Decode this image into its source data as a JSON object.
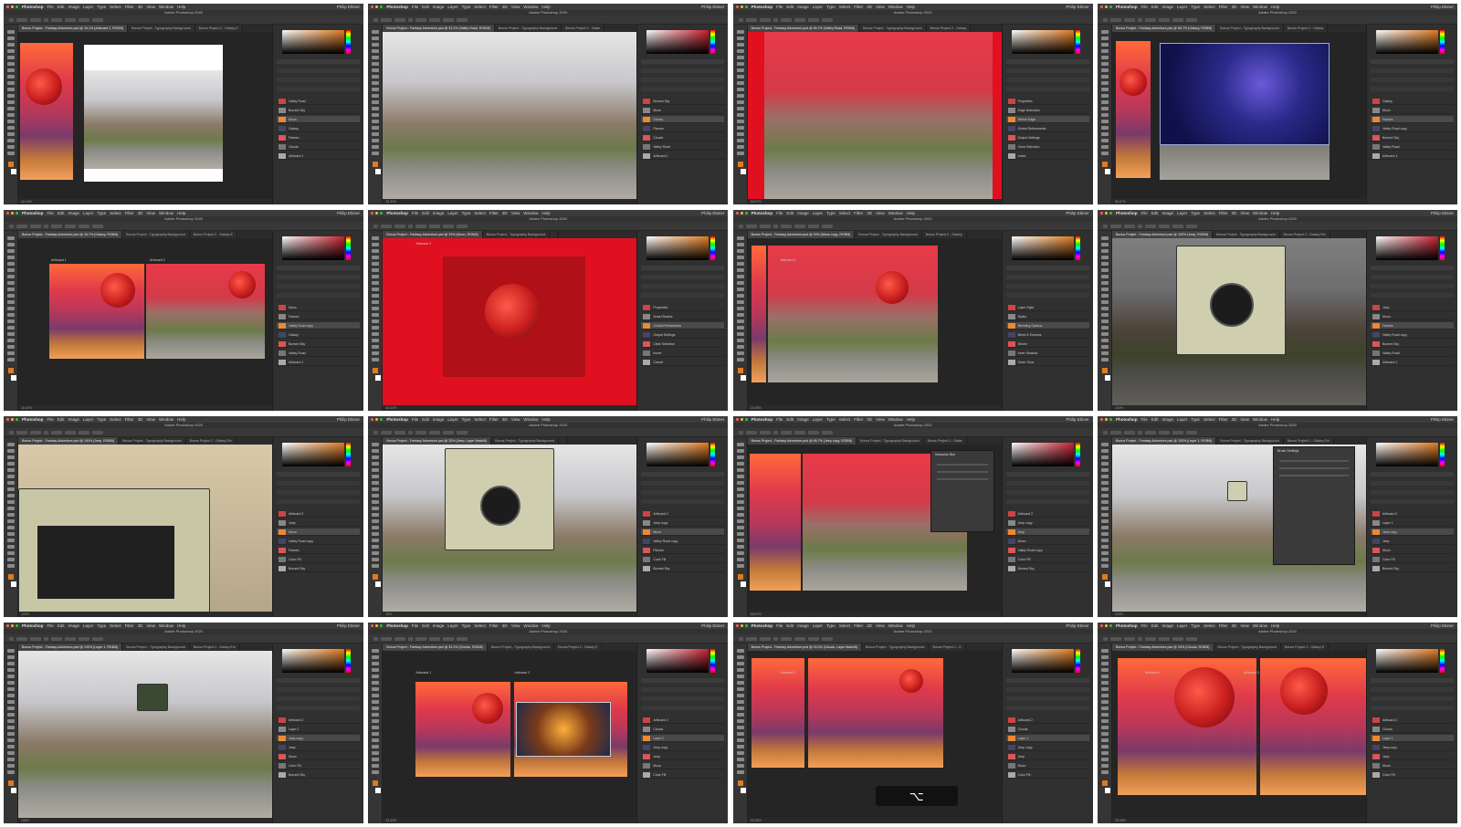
{
  "app": {
    "name": "Photoshop",
    "menus": [
      "File",
      "Edit",
      "Image",
      "Layer",
      "Type",
      "Select",
      "Filter",
      "3D",
      "View",
      "Window",
      "Help"
    ],
    "user": "Philip Ebiner",
    "window_title": "Adobe Photoshop 2020"
  },
  "colors": {
    "mac_close": "#ff5f57",
    "mac_min": "#febc2e",
    "mac_max": "#28c840",
    "accent_red": "#e01020",
    "panel_dark": "#303030"
  },
  "tiles": [
    {
      "doc_tab": "Bonus Project - Fantasy Adventure.psd @ 16.1% (Artboard 2, RGB/8)",
      "tab2": "Bonus Project - Typography Background",
      "tab3": "Bonus Project 2 - Galaxy E",
      "status": "16.14%",
      "layers": [
        "Valley Road",
        "Burned Sky",
        "Moon",
        "Galaxy",
        "Flames",
        "Clouds",
        "Artboard 1"
      ]
    },
    {
      "doc_tab": "Bonus Project - Fantasy Adventure.psd @ 33.3% (Valley Road, RGB/8)",
      "tab2": "Bonus Project - Typography Background",
      "tab3": "Bonus Project 2 - Galax",
      "status": "33.33%",
      "layers": [
        "Burned Sky",
        "Moon",
        "Galaxy",
        "Flames",
        "Clouds",
        "Valley Road",
        "Artboard 1"
      ]
    },
    {
      "doc_tab": "Bonus Project - Fantasy Adventure.psd @ 66.7% (Valley Road, RGB/8)",
      "tab2": "Bonus Project - Typography Background",
      "tab3": "Bonus Project 2 - Galaxy",
      "status": "66.67%",
      "layers": [
        "Properties",
        "Edge Detection",
        "Refine Edge",
        "Global Refinements",
        "Output Settings",
        "Clear Selection",
        "Invert"
      ]
    },
    {
      "doc_tab": "Bonus Project - Fantasy Adventure.psd @ 66.7% (Galaxy, RGB/8)",
      "tab2": "Bonus Project - Typography Background",
      "tab3": "Bonus Project 2 - Galaxy",
      "status": "66.67%",
      "layers": [
        "Galaxy",
        "Moon",
        "Flames",
        "Valley Road copy",
        "Burned Sky",
        "Valley Road",
        "Artboard 1"
      ]
    },
    {
      "doc_tab": "Bonus Project - Fantasy Adventure.psd @ 16.7% (Galaxy, RGB/8)",
      "tab2": "Bonus Project - Typography Background",
      "tab3": "Bonus Project 2 - Galaxy E",
      "status": "16.67%",
      "layers": [
        "Moon",
        "Flames",
        "Valley Road copy",
        "Galaxy",
        "Burned Sky",
        "Valley Road",
        "Artboard 1"
      ],
      "artboard_labels": [
        "Artboard 1",
        "Artboard 2"
      ]
    },
    {
      "doc_tab": "Bonus Project - Fantasy Adventure.psd @ 33% (Moon, RGB/8)",
      "tab2": "Bonus Project - Typography Background",
      "tab3": "",
      "status": "33.33%",
      "layers": [
        "Properties",
        "Smart Radius",
        "Global Refinements",
        "Output Settings",
        "Clear Selection",
        "Invert",
        "Cancel"
      ],
      "artboard_labels": [
        "Artboard 2"
      ]
    },
    {
      "doc_tab": "Bonus Project - Fantasy Adventure.psd @ 33% (Moon copy, RGB/8)",
      "tab2": "Bonus Project - Typography Background",
      "tab3": "Bonus Project 2 - Galaxy",
      "status": "33.33%",
      "layers": [
        "Layer Style",
        "Styles",
        "Blending Options",
        "Bevel & Emboss",
        "Stroke",
        "Inner Shadow",
        "Outer Glow"
      ],
      "artboard_labels": [
        "Artboard 2"
      ]
    },
    {
      "doc_tab": "Bonus Project - Fantasy Adventure.psd @ 100% (Jeep, RGB/8)",
      "tab2": "Bonus Project - Typography Background",
      "tab3": "Bonus Project 2 - Galaxy Ext",
      "status": "100%",
      "layers": [
        "Jeep",
        "Moon",
        "Flames",
        "Valley Road copy",
        "Burned Sky",
        "Valley Road",
        "Artboard 1"
      ]
    },
    {
      "doc_tab": "Bonus Project - Fantasy Adventure.psd @ 100% (Jeep, RGB/8)",
      "tab2": "Bonus Project - Typography Background",
      "tab3": "Bonus Project 2 - Galaxy Ext",
      "status": "100%",
      "layers": [
        "Artboard 2",
        "Jeep",
        "Moon",
        "Valley Road copy",
        "Flames",
        "Color Fill",
        "Burned Sky"
      ]
    },
    {
      "doc_tab": "Bonus Project - Fantasy Adventure.psd @ 25% (Jeep, Layer Mask/8)",
      "tab2": "Bonus Project - Typography Background",
      "tab3": "",
      "status": "25%",
      "layers": [
        "Artboard 2",
        "Jeep copy",
        "Moon",
        "Valley Road copy",
        "Flames",
        "Color Fill",
        "Burned Sky"
      ]
    },
    {
      "doc_tab": "Bonus Project - Fantasy Adventure.psd @ 66.7% (Jeep copy, RGB/8)",
      "tab2": "Bonus Project - Typography Background",
      "tab3": "Bonus Project 2 - Galax",
      "status": "66.67%",
      "layers": [
        "Artboard 2",
        "Jeep copy",
        "Jeep",
        "Moon",
        "Valley Road copy",
        "Color Fill",
        "Burned Sky"
      ],
      "dialog": "Gaussian Blur"
    },
    {
      "doc_tab": "Bonus Project - Fantasy Adventure.psd @ 100% (Layer 1, RGB/8)",
      "tab2": "Bonus Project - Typography Background",
      "tab3": "Bonus Project 2 - Galaxy Ext",
      "status": "100%",
      "layers": [
        "Artboard 2",
        "Layer 1",
        "Jeep copy",
        "Jeep",
        "Moon",
        "Color Fill",
        "Burned Sky"
      ],
      "dialog": "Brush Settings"
    },
    {
      "doc_tab": "Bonus Project - Fantasy Adventure.psd @ 100% (Layer 1, RGB/8)",
      "tab2": "Bonus Project - Typography Background",
      "tab3": "Bonus Project 2 - Galaxy Ext",
      "status": "100%",
      "layers": [
        "Artboard 2",
        "Layer 1",
        "Jeep copy",
        "Jeep",
        "Moon",
        "Color Fill",
        "Burned Sky"
      ]
    },
    {
      "doc_tab": "Bonus Project - Fantasy Adventure.psd @ 33.3% (Clouds, RGB/8)",
      "tab2": "Bonus Project - Typography Background",
      "tab3": "Bonus Project 2 - Galaxy E",
      "status": "33.33%",
      "layers": [
        "Artboard 2",
        "Clouds",
        "Layer 1",
        "Jeep copy",
        "Jeep",
        "Moon",
        "Color Fill"
      ],
      "artboard_labels": [
        "Artboard 1",
        "Artboard 2"
      ]
    },
    {
      "doc_tab": "Bonus Project - Fantasy Adventure.psd @ 33.3% (Clouds, Layer Mask/8)",
      "tab2": "Bonus Project - Typography Background",
      "tab3": "Bonus Project 2 - G",
      "status": "33.33%",
      "layers": [
        "Artboard 2",
        "Clouds",
        "Layer 1",
        "Jeep copy",
        "Jeep",
        "Moon",
        "Color Fill"
      ],
      "artboard_labels": [
        "Artboard 2"
      ],
      "keycap": "⌥"
    },
    {
      "doc_tab": "Bonus Project - Fantasy Adventure.psd @ 33% (Clouds, RGB/8)",
      "tab2": "Bonus Project - Typography Background",
      "tab3": "Bonus Project 2 - Galaxy E",
      "status": "33.33%",
      "layers": [
        "Artboard 2",
        "Clouds",
        "Layer 1",
        "Jeep copy",
        "Jeep",
        "Moon",
        "Color Fill"
      ],
      "artboard_labels": [
        "Artboard 1",
        "Artboard 2"
      ]
    }
  ]
}
